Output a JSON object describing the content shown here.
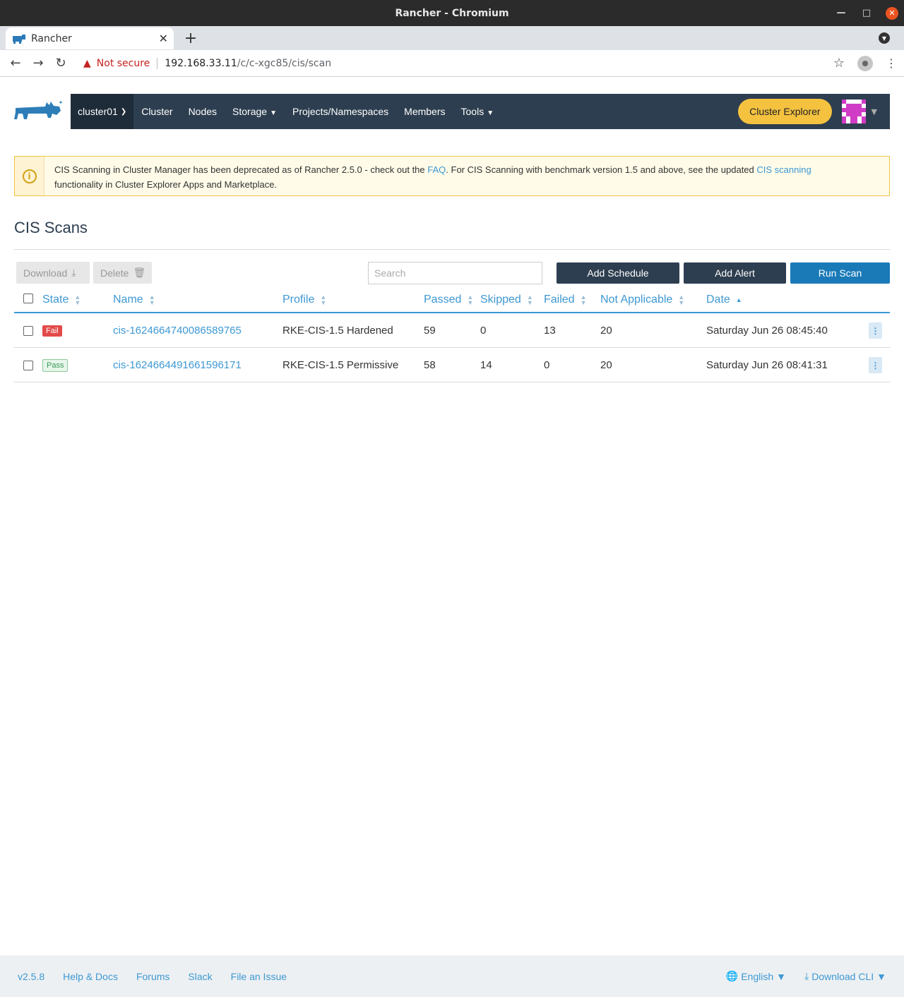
{
  "window": {
    "title": "Rancher - Chromium"
  },
  "browser": {
    "tab_title": "Rancher",
    "security_label": "Not secure",
    "url_host": "192.168.33.11",
    "url_path": "/c/c-xgc85/cis/scan"
  },
  "header": {
    "cluster": "cluster01",
    "nav": {
      "cluster": "Cluster",
      "nodes": "Nodes",
      "storage": "Storage",
      "projects": "Projects/Namespaces",
      "members": "Members",
      "tools": "Tools"
    },
    "cluster_explorer": "Cluster Explorer"
  },
  "banner": {
    "text_1": "CIS Scanning in Cluster Manager has been deprecated as of Rancher 2.5.0 - check out the ",
    "faq_link": "FAQ",
    "text_2": ". For CIS Scanning with benchmark version 1.5 and above, see the updated ",
    "cis_link": "CIS scanning",
    "text_3": "functionality in Cluster Explorer Apps and Marketplace."
  },
  "page": {
    "title": "CIS Scans"
  },
  "toolbar": {
    "download": "Download",
    "delete": "Delete",
    "search_placeholder": "Search",
    "add_schedule": "Add Schedule",
    "add_alert": "Add Alert",
    "run_scan": "Run Scan"
  },
  "table": {
    "columns": {
      "state": "State",
      "name": "Name",
      "profile": "Profile",
      "passed": "Passed",
      "skipped": "Skipped",
      "failed": "Failed",
      "not_applicable": "Not Applicable",
      "date": "Date"
    },
    "rows": [
      {
        "state": "Fail",
        "name": "cis-1624664740086589765",
        "profile": "RKE-CIS-1.5 Hardened",
        "passed": "59",
        "skipped": "0",
        "failed": "13",
        "not_applicable": "20",
        "date": "Saturday Jun 26 08:45:40"
      },
      {
        "state": "Pass",
        "name": "cis-1624664491661596171",
        "profile": "RKE-CIS-1.5 Permissive",
        "passed": "58",
        "skipped": "14",
        "failed": "0",
        "not_applicable": "20",
        "date": "Saturday Jun 26 08:41:31"
      }
    ]
  },
  "footer": {
    "version": "v2.5.8",
    "help": "Help & Docs",
    "forums": "Forums",
    "slack": "Slack",
    "issue": "File an Issue",
    "language": "English",
    "download_cli": "Download CLI"
  },
  "colors": {
    "nav_bg": "#2d3e50",
    "accent_link": "#3d98d3",
    "cluster_explorer_btn": "#f5c240",
    "run_scan_btn": "#1a7ab8",
    "fail_badge": "#e24a4a",
    "pass_badge": "#3a9a5a"
  },
  "icons": [
    "rancher-logo",
    "info-icon",
    "download-icon",
    "trash-icon",
    "sort-icon",
    "kebab-icon",
    "globe-icon"
  ]
}
